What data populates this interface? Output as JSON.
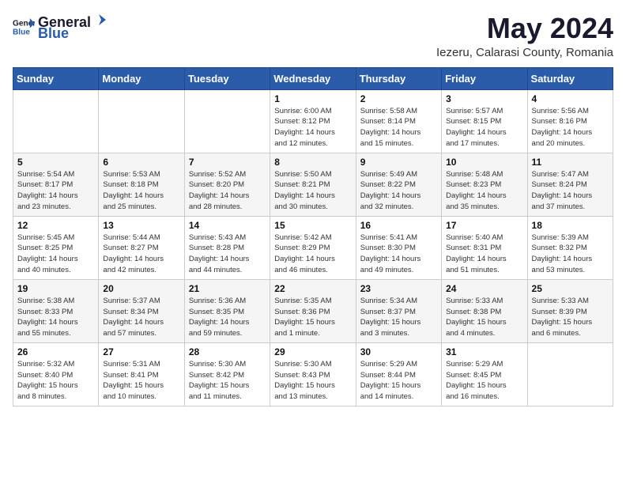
{
  "header": {
    "logo_general": "General",
    "logo_blue": "Blue",
    "month_title": "May 2024",
    "location": "Iezeru, Calarasi County, Romania"
  },
  "weekdays": [
    "Sunday",
    "Monday",
    "Tuesday",
    "Wednesday",
    "Thursday",
    "Friday",
    "Saturday"
  ],
  "weeks": [
    [
      {
        "day": "",
        "info": ""
      },
      {
        "day": "",
        "info": ""
      },
      {
        "day": "",
        "info": ""
      },
      {
        "day": "1",
        "info": "Sunrise: 6:00 AM\nSunset: 8:12 PM\nDaylight: 14 hours\nand 12 minutes."
      },
      {
        "day": "2",
        "info": "Sunrise: 5:58 AM\nSunset: 8:14 PM\nDaylight: 14 hours\nand 15 minutes."
      },
      {
        "day": "3",
        "info": "Sunrise: 5:57 AM\nSunset: 8:15 PM\nDaylight: 14 hours\nand 17 minutes."
      },
      {
        "day": "4",
        "info": "Sunrise: 5:56 AM\nSunset: 8:16 PM\nDaylight: 14 hours\nand 20 minutes."
      }
    ],
    [
      {
        "day": "5",
        "info": "Sunrise: 5:54 AM\nSunset: 8:17 PM\nDaylight: 14 hours\nand 23 minutes."
      },
      {
        "day": "6",
        "info": "Sunrise: 5:53 AM\nSunset: 8:18 PM\nDaylight: 14 hours\nand 25 minutes."
      },
      {
        "day": "7",
        "info": "Sunrise: 5:52 AM\nSunset: 8:20 PM\nDaylight: 14 hours\nand 28 minutes."
      },
      {
        "day": "8",
        "info": "Sunrise: 5:50 AM\nSunset: 8:21 PM\nDaylight: 14 hours\nand 30 minutes."
      },
      {
        "day": "9",
        "info": "Sunrise: 5:49 AM\nSunset: 8:22 PM\nDaylight: 14 hours\nand 32 minutes."
      },
      {
        "day": "10",
        "info": "Sunrise: 5:48 AM\nSunset: 8:23 PM\nDaylight: 14 hours\nand 35 minutes."
      },
      {
        "day": "11",
        "info": "Sunrise: 5:47 AM\nSunset: 8:24 PM\nDaylight: 14 hours\nand 37 minutes."
      }
    ],
    [
      {
        "day": "12",
        "info": "Sunrise: 5:45 AM\nSunset: 8:25 PM\nDaylight: 14 hours\nand 40 minutes."
      },
      {
        "day": "13",
        "info": "Sunrise: 5:44 AM\nSunset: 8:27 PM\nDaylight: 14 hours\nand 42 minutes."
      },
      {
        "day": "14",
        "info": "Sunrise: 5:43 AM\nSunset: 8:28 PM\nDaylight: 14 hours\nand 44 minutes."
      },
      {
        "day": "15",
        "info": "Sunrise: 5:42 AM\nSunset: 8:29 PM\nDaylight: 14 hours\nand 46 minutes."
      },
      {
        "day": "16",
        "info": "Sunrise: 5:41 AM\nSunset: 8:30 PM\nDaylight: 14 hours\nand 49 minutes."
      },
      {
        "day": "17",
        "info": "Sunrise: 5:40 AM\nSunset: 8:31 PM\nDaylight: 14 hours\nand 51 minutes."
      },
      {
        "day": "18",
        "info": "Sunrise: 5:39 AM\nSunset: 8:32 PM\nDaylight: 14 hours\nand 53 minutes."
      }
    ],
    [
      {
        "day": "19",
        "info": "Sunrise: 5:38 AM\nSunset: 8:33 PM\nDaylight: 14 hours\nand 55 minutes."
      },
      {
        "day": "20",
        "info": "Sunrise: 5:37 AM\nSunset: 8:34 PM\nDaylight: 14 hours\nand 57 minutes."
      },
      {
        "day": "21",
        "info": "Sunrise: 5:36 AM\nSunset: 8:35 PM\nDaylight: 14 hours\nand 59 minutes."
      },
      {
        "day": "22",
        "info": "Sunrise: 5:35 AM\nSunset: 8:36 PM\nDaylight: 15 hours\nand 1 minute."
      },
      {
        "day": "23",
        "info": "Sunrise: 5:34 AM\nSunset: 8:37 PM\nDaylight: 15 hours\nand 3 minutes."
      },
      {
        "day": "24",
        "info": "Sunrise: 5:33 AM\nSunset: 8:38 PM\nDaylight: 15 hours\nand 4 minutes."
      },
      {
        "day": "25",
        "info": "Sunrise: 5:33 AM\nSunset: 8:39 PM\nDaylight: 15 hours\nand 6 minutes."
      }
    ],
    [
      {
        "day": "26",
        "info": "Sunrise: 5:32 AM\nSunset: 8:40 PM\nDaylight: 15 hours\nand 8 minutes."
      },
      {
        "day": "27",
        "info": "Sunrise: 5:31 AM\nSunset: 8:41 PM\nDaylight: 15 hours\nand 10 minutes."
      },
      {
        "day": "28",
        "info": "Sunrise: 5:30 AM\nSunset: 8:42 PM\nDaylight: 15 hours\nand 11 minutes."
      },
      {
        "day": "29",
        "info": "Sunrise: 5:30 AM\nSunset: 8:43 PM\nDaylight: 15 hours\nand 13 minutes."
      },
      {
        "day": "30",
        "info": "Sunrise: 5:29 AM\nSunset: 8:44 PM\nDaylight: 15 hours\nand 14 minutes."
      },
      {
        "day": "31",
        "info": "Sunrise: 5:29 AM\nSunset: 8:45 PM\nDaylight: 15 hours\nand 16 minutes."
      },
      {
        "day": "",
        "info": ""
      }
    ]
  ]
}
